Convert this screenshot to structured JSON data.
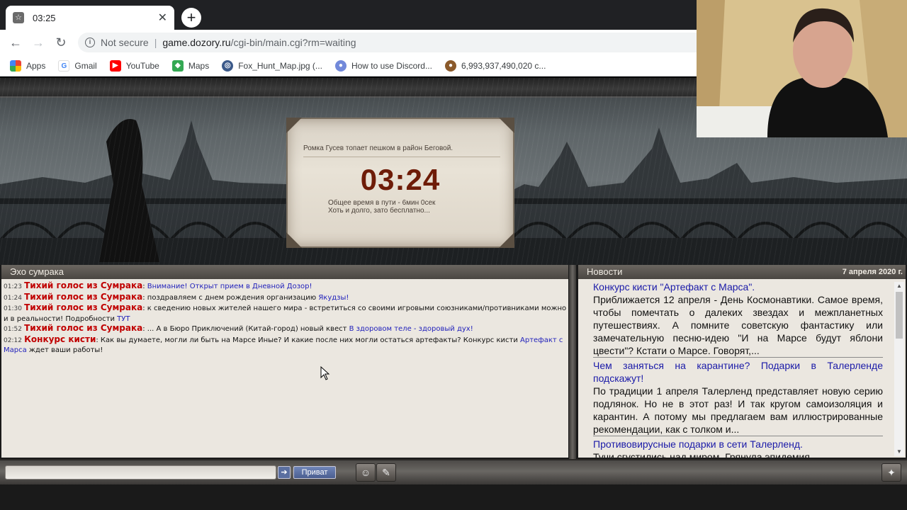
{
  "browser": {
    "tab_title": "03:25",
    "tab_close": "✕",
    "new_tab": "+",
    "security_label": "Not secure",
    "url_host": "game.dozory.ru",
    "url_path": "/cgi-bin/main.cgi?rm=waiting",
    "bookmarks": [
      {
        "label": "Apps",
        "icon": "apps-grid-icon"
      },
      {
        "label": "Gmail",
        "icon": "google-icon"
      },
      {
        "label": "YouTube",
        "icon": "youtube-icon"
      },
      {
        "label": "Maps",
        "icon": "maps-icon"
      },
      {
        "label": "Fox_Hunt_Map.jpg (...",
        "icon": "globe-icon"
      },
      {
        "label": "How to use Discord...",
        "icon": "discord-icon"
      },
      {
        "label": "6,993,937,490,020 c...",
        "icon": "cookie-icon"
      }
    ]
  },
  "timer": {
    "message": "Ромка Гусев топает пешком в район Беговой.",
    "clock": "03:24",
    "line1": "Общее время в пути - 6мин 0сек",
    "line2": "Хоть и долго, зато бесплатно..."
  },
  "echo": {
    "title": "Эхо сумрака",
    "messages": [
      {
        "time": "01:23",
        "sender": "Тихий голос из Сумрака",
        "text": "",
        "link": "Внимание! Открыт прием в Дневной Дозор!",
        "after": ""
      },
      {
        "time": "01:24",
        "sender": "Тихий голос из Сумрака",
        "text": "поздравляем с днем рождения организацию ",
        "link": "Якудзы!",
        "after": ""
      },
      {
        "time": "01:30",
        "sender": "Тихий голос из Сумрака",
        "text": "к сведению новых жителей нашего мира - встретиться со своими игровыми союзниками/противниками можно и в реальности! Подробности ",
        "link": "ТУТ",
        "after": ""
      },
      {
        "time": "01:52",
        "sender": "Тихий голос из Сумрака",
        "text": "... А в Бюро Приключений (Китай-город) новый квест ",
        "link": "В здоровом теле - здоровый дух!",
        "after": ""
      },
      {
        "time": "02:12",
        "sender": "Конкурс кисти",
        "text": "Как вы думаете, могли ли быть на Марсе Иные? И какие после них могли остаться артефакты? Конкурс кисти ",
        "link": "Артефакт с Марса",
        "after": " ждет ваши работы!"
      }
    ]
  },
  "news": {
    "title": "Новости",
    "date": "7 апреля 2020 г.",
    "items": [
      {
        "title": "Конкурс кисти \"Артефакт с Марса\".",
        "body": "Приближается 12 апреля - День Космонавтики. Самое время, чтобы помечтать о далеких звездах и межпланетных путешествиях. А помните советскую фантастику или замечательную песню-идею \"И на Марсе будут яблони цвести\"? Кстати о Марсе. Говорят,..."
      },
      {
        "title": "Чем заняться на карантине? Подарки в Талерленде подскажут!",
        "body": "По традиции 1 апреля Талерленд представляет новую серию подлянок. Но не в этот раз! И так кругом самоизоляция и карантин. А потому мы предлагаем вам иллюстрированные рекомендации, как с толком и..."
      },
      {
        "title": "Противовирусные подарки в сети Талерленд.",
        "body": "Тучи сгустились над миром. Грянула эпидемия"
      }
    ]
  },
  "bottom": {
    "send_icon": "➔",
    "privat_label": "Приват"
  }
}
